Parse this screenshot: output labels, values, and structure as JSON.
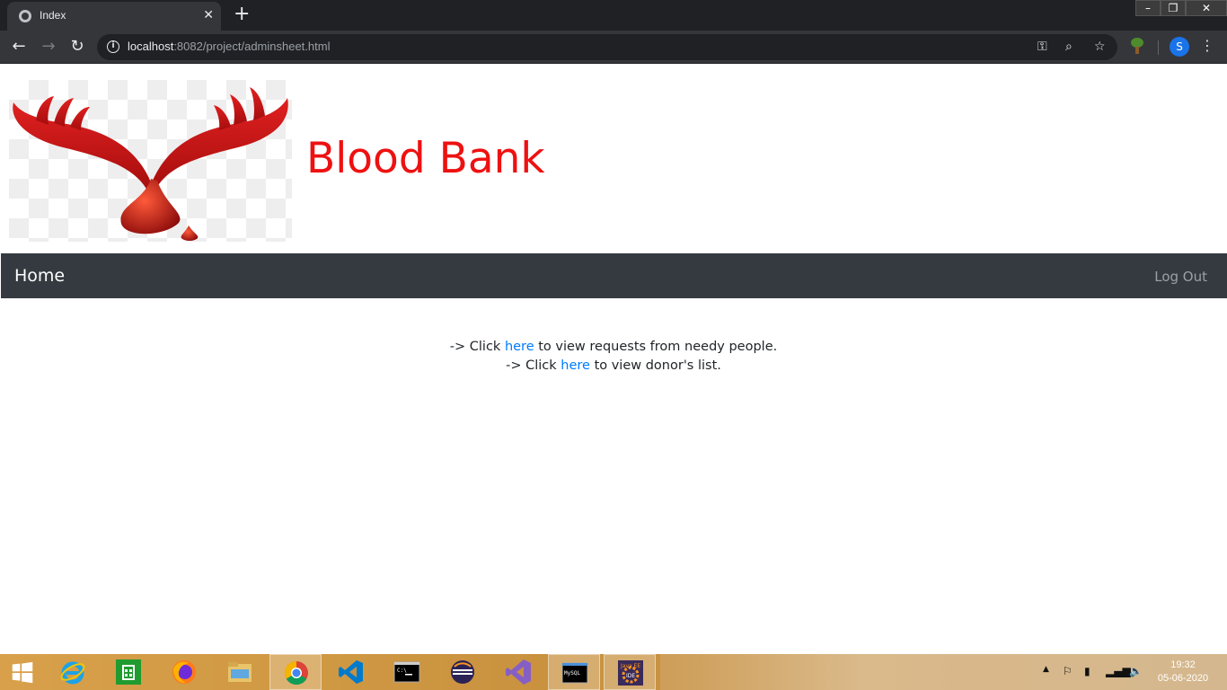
{
  "browser": {
    "tab_title": "Index",
    "url_host": "localhost",
    "url_rest": ":8082/project/adminsheet.html"
  },
  "site": {
    "title": "Blood Bank",
    "nav_home": "Home",
    "nav_logout": "Log Out"
  },
  "content": {
    "line1_prefix": "-> Click",
    "line1_link": "here",
    "line1_suffix": "to view requests from needy people.",
    "line2_prefix": "-> Click",
    "line2_link": "here",
    "line2_suffix": "to view donor's list."
  },
  "taskbar": {
    "apps": [
      "start-icon",
      "internet-explorer-icon",
      "store-icon",
      "firefox-icon",
      "file-explorer-icon",
      "chrome-icon",
      "vscode-icon",
      "cmd-icon",
      "eclipse-icon",
      "visual-studio-icon",
      "mysql-icon",
      "java-ee-ide-icon"
    ],
    "time": "19:32",
    "date": "05-06-2020"
  },
  "colors": {
    "title_red": "#ee1111",
    "navbar_bg": "#343a40",
    "link_blue": "#007bff"
  }
}
